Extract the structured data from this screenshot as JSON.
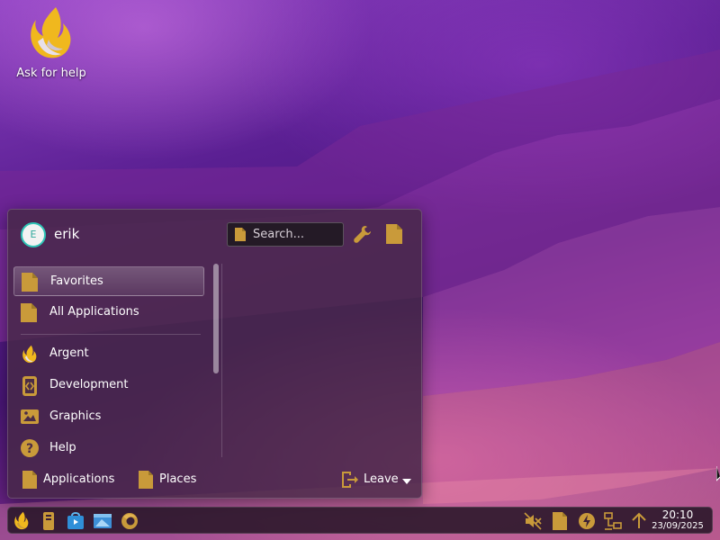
{
  "desktop": {
    "icons": [
      {
        "label": "Ask for help",
        "icon": "argent-flame-icon"
      }
    ]
  },
  "launcher": {
    "user": {
      "initial": "E",
      "name": "erik"
    },
    "search": {
      "placeholder": "Search..."
    },
    "header_buttons": [
      {
        "icon": "wrench-icon"
      },
      {
        "icon": "document-icon"
      }
    ],
    "categories": [
      {
        "label": "Favorites",
        "icon": "document-icon",
        "active": true
      },
      {
        "label": "All Applications",
        "icon": "document-icon"
      },
      {
        "label": "Argent",
        "icon": "argent-flame-icon"
      },
      {
        "label": "Development",
        "icon": "development-icon"
      },
      {
        "label": "Graphics",
        "icon": "image-icon"
      },
      {
        "label": "Help",
        "icon": "help-icon"
      }
    ],
    "footer": {
      "applications_label": "Applications",
      "places_label": "Places",
      "leave_label": "Leave"
    }
  },
  "taskbar": {
    "pinned": [
      {
        "icon": "argent-flame-icon"
      },
      {
        "icon": "system-monitor-icon"
      },
      {
        "icon": "store-icon"
      },
      {
        "icon": "file-manager-icon"
      },
      {
        "icon": "firefox-icon"
      }
    ],
    "tray": [
      {
        "icon": "volume-muted-icon"
      },
      {
        "icon": "document-icon"
      },
      {
        "icon": "power-icon"
      },
      {
        "icon": "network-icon"
      },
      {
        "icon": "arrow-up-icon"
      }
    ],
    "clock": {
      "time": "20:10",
      "date": "23/09/2025"
    }
  },
  "colors": {
    "accent": "#c99a3a",
    "flame": "#f0b81e",
    "avatar_ring": "#2ec4b6"
  }
}
